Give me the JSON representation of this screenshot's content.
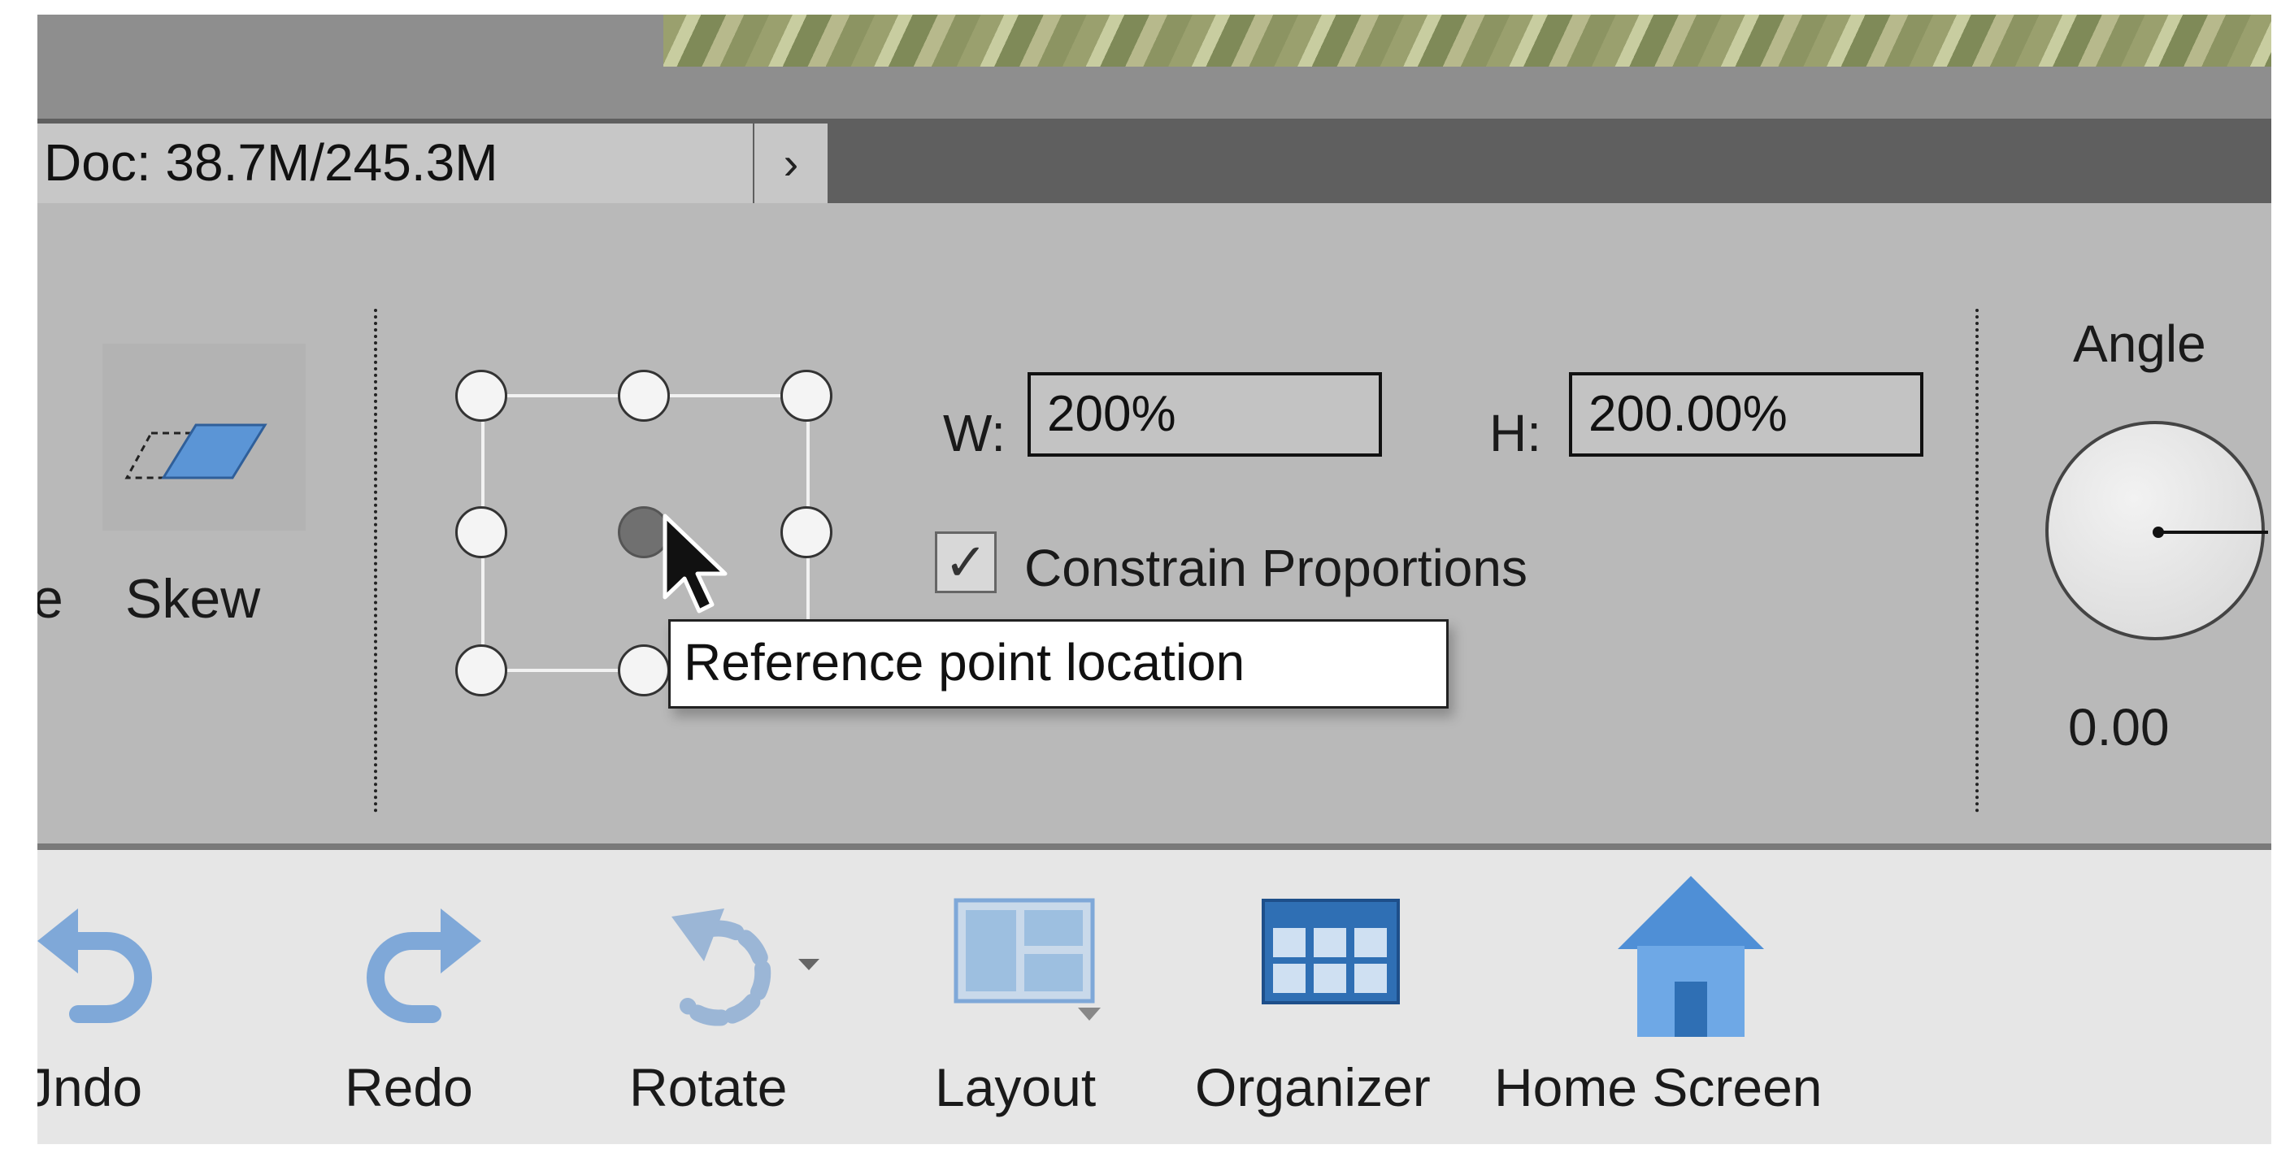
{
  "status": {
    "doc_size": "Doc: 38.7M/245.3M",
    "arrow": "›"
  },
  "options": {
    "left_cut_label": "e",
    "skew_label": "Skew",
    "width_label": "W:",
    "width_value": "200%",
    "height_label": "H:",
    "height_value": "200.00%",
    "constrain_label": "Constrain Proportions",
    "constrain_checked": true,
    "checkmark": "✓",
    "tooltip": "Reference point location",
    "angle_label": "Angle",
    "angle_value": "0.00"
  },
  "toolbar": {
    "items": [
      {
        "label": "Jndo",
        "icon": "undo-icon"
      },
      {
        "label": "Redo",
        "icon": "redo-icon"
      },
      {
        "label": "Rotate",
        "icon": "rotate-icon"
      },
      {
        "label": "Layout",
        "icon": "layout-icon"
      },
      {
        "label": "Organizer",
        "icon": "organizer-icon"
      },
      {
        "label": "Home Screen",
        "icon": "home-icon"
      }
    ]
  },
  "colors": {
    "accent_blue": "#5b95d6",
    "panel_gray": "#b9b9b9"
  }
}
